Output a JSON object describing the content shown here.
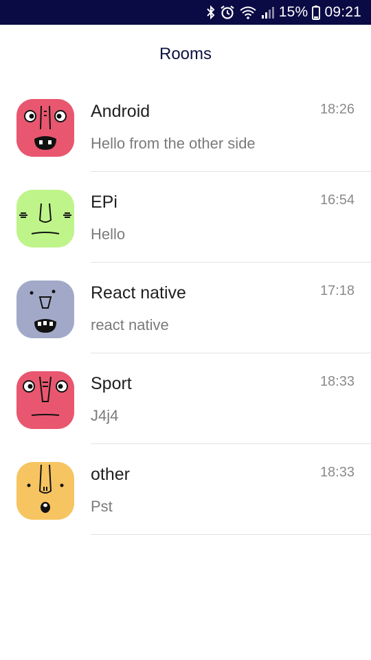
{
  "status_bar": {
    "icons": [
      "bluetooth-icon",
      "alarm-icon",
      "wifi-icon",
      "signal-icon",
      "battery-icon"
    ],
    "battery": "15%",
    "time": "09:21",
    "background": "#0a0a45"
  },
  "header": {
    "title": "Rooms"
  },
  "rooms": [
    {
      "name": "Android",
      "last_message": "Hello from the other side",
      "time": "18:26",
      "avatar_color": "#e8576f",
      "avatar_icon": "monster-face-avatar"
    },
    {
      "name": "EPi",
      "last_message": "Hello",
      "time": "16:54",
      "avatar_color": "#bff48a",
      "avatar_icon": "monster-face-avatar"
    },
    {
      "name": "React native",
      "last_message": "react native",
      "time": "17:18",
      "avatar_color": "#a2a9c8",
      "avatar_icon": "monster-face-avatar"
    },
    {
      "name": "Sport",
      "last_message": "J4j4",
      "time": "18:33",
      "avatar_color": "#e8576f",
      "avatar_icon": "monster-face-avatar"
    },
    {
      "name": "other",
      "last_message": "Pst",
      "time": "18:33",
      "avatar_color": "#f6c461",
      "avatar_icon": "monster-face-avatar"
    }
  ]
}
